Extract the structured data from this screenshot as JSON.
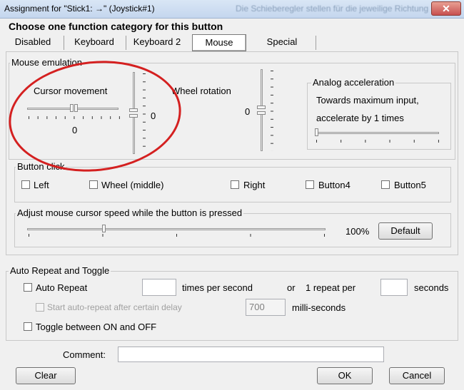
{
  "window": {
    "title": "Assignment for \"Stick1: →\" (Joystick#1)",
    "background_title": "Die Schieberegler stellen für die jeweilige Richtung",
    "close_label": "✕"
  },
  "heading": "Choose one function category for this button",
  "tabs": [
    "Disabled",
    "Keyboard",
    "Keyboard 2",
    "Mouse",
    "Special"
  ],
  "active_tab": "Mouse",
  "mouse_emulation": {
    "legend": "Mouse emulation",
    "cursor_movement": {
      "label": "Cursor movement",
      "x_value": "0",
      "y_value": "0"
    },
    "wheel_rotation": {
      "label": "Wheel rotation",
      "value": "0"
    },
    "analog": {
      "legend": "Analog acceleration",
      "line1": "Towards maximum input,",
      "line2": "accelerate by 1 times"
    }
  },
  "button_click": {
    "legend": "Button click",
    "options": [
      "Left",
      "Wheel (middle)",
      "Right",
      "Button4",
      "Button5"
    ]
  },
  "speed": {
    "legend": "Adjust mouse cursor speed while the button is pressed",
    "value": "100%",
    "default_label": "Default"
  },
  "auto_repeat": {
    "legend": "Auto Repeat and Toggle",
    "auto_repeat_label": "Auto Repeat",
    "times_per_second_label": "times per second",
    "or_label": "or",
    "repeat_per_label": "1 repeat per",
    "seconds_label": "seconds",
    "delay_label": "Start auto-repeat after certain delay",
    "delay_value": "700",
    "ms_label": "milli-seconds",
    "toggle_label": "Toggle between ON and OFF"
  },
  "comment": {
    "label": "Comment:",
    "value": ""
  },
  "buttons": {
    "clear": "Clear",
    "ok": "OK",
    "cancel": "Cancel"
  },
  "annotation_color": "#d42020"
}
